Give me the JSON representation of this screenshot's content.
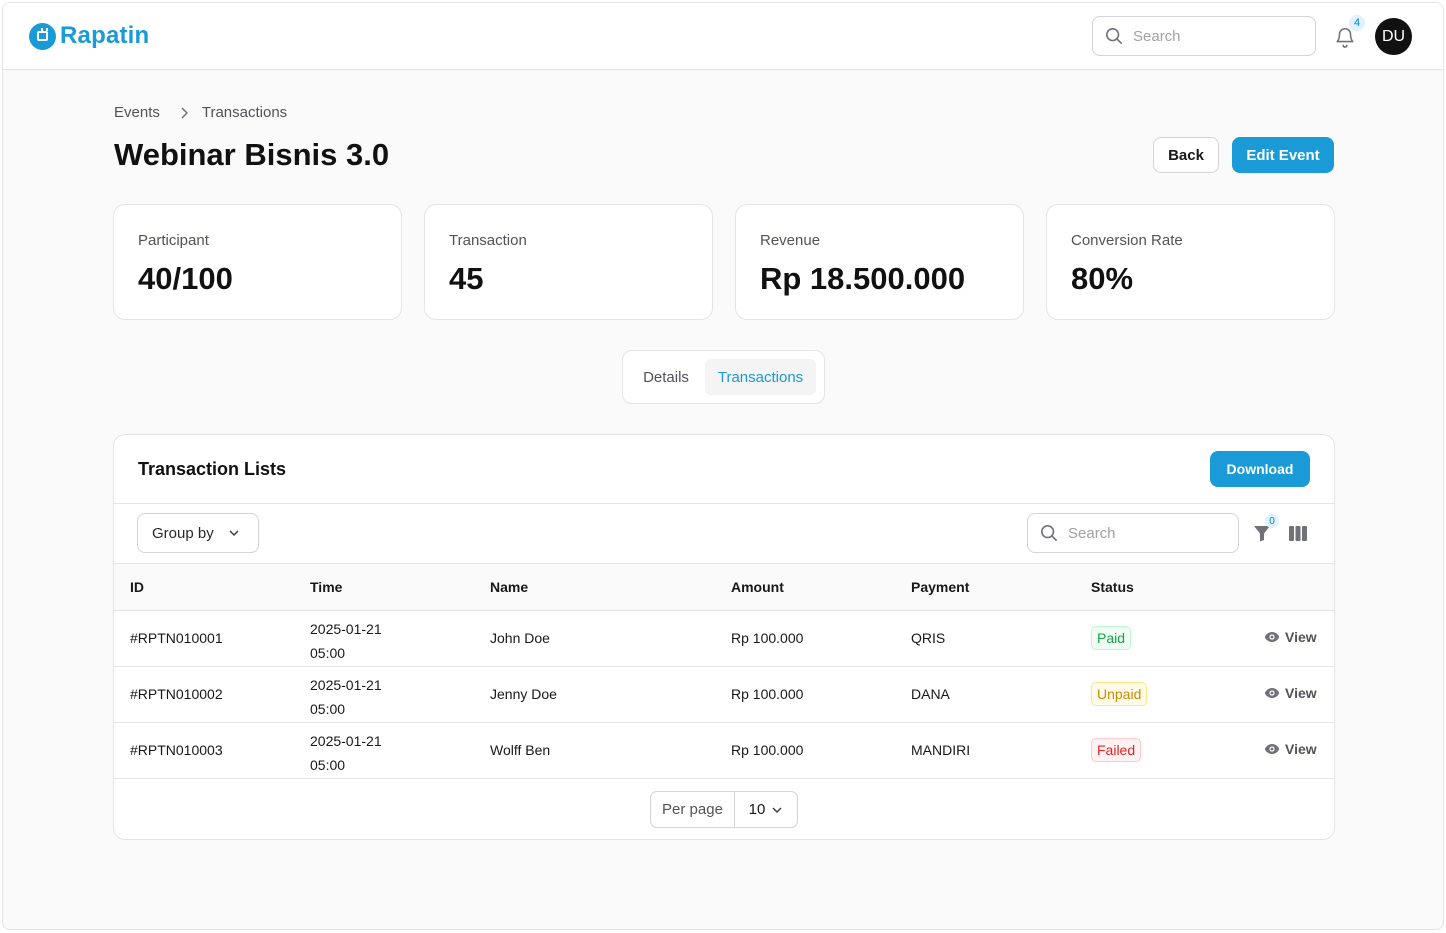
{
  "app": {
    "name": "Rapatin",
    "brand_color": "#1a9ad6",
    "search_placeholder": "Search",
    "notification_count": "4",
    "user_initials": "DU"
  },
  "breadcrumb": {
    "items": [
      "Events",
      "Transactions"
    ]
  },
  "page": {
    "title": "Webinar Bisnis 3.0",
    "back_label": "Back",
    "edit_label": "Edit Event"
  },
  "stats": [
    {
      "label": "Participant",
      "value": "40/100"
    },
    {
      "label": "Transaction",
      "value": "45"
    },
    {
      "label": "Revenue",
      "value": "Rp 18.500.000"
    },
    {
      "label": "Conversion Rate",
      "value": "80%"
    }
  ],
  "tabs": [
    {
      "label": "Details",
      "active": false
    },
    {
      "label": "Transactions",
      "active": true
    }
  ],
  "transactions": {
    "title": "Transaction Lists",
    "download_label": "Download",
    "group_by_label": "Group by",
    "search_placeholder": "Search",
    "filter_count": "0",
    "columns": [
      "ID",
      "Time",
      "Name",
      "Amount",
      "Payment",
      "Status"
    ],
    "view_label": "View",
    "rows": [
      {
        "id": "#RPTN010001",
        "date": "2025-01-21",
        "time": "05:00",
        "name": "John Doe",
        "amount": "Rp 100.000",
        "payment": "QRIS",
        "status": "Paid"
      },
      {
        "id": "#RPTN010002",
        "date": "2025-01-21",
        "time": "05:00",
        "name": "Jenny Doe",
        "amount": "Rp 100.000",
        "payment": "DANA",
        "status": "Unpaid"
      },
      {
        "id": "#RPTN010003",
        "date": "2025-01-21",
        "time": "05:00",
        "name": "Wolff Ben",
        "amount": "Rp 100.000",
        "payment": "MANDIRI",
        "status": "Failed"
      }
    ],
    "per_page_label": "Per page",
    "per_page_value": "10"
  }
}
